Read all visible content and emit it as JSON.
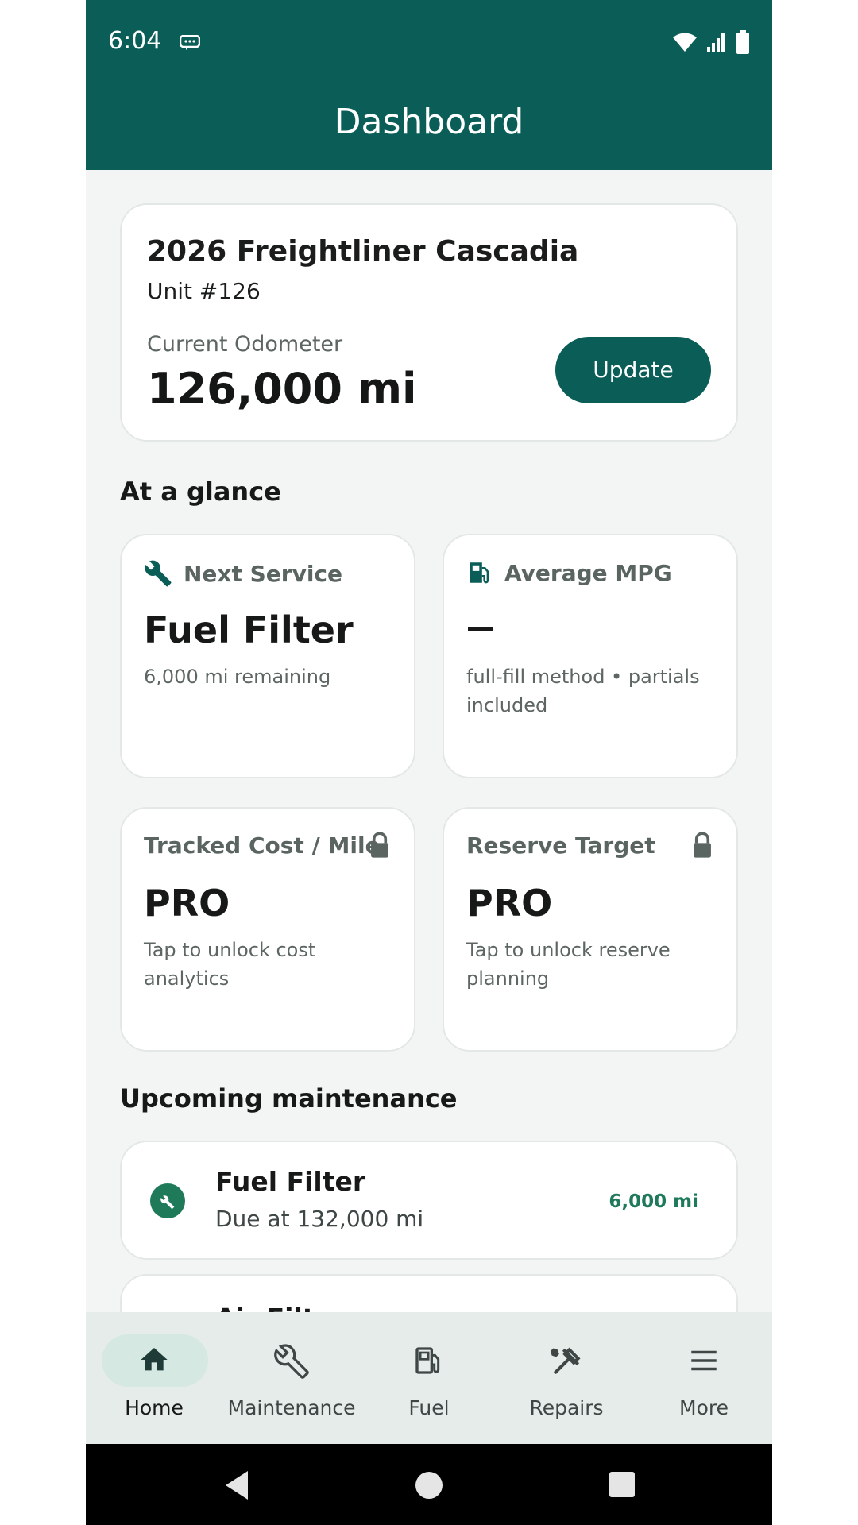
{
  "status_bar": {
    "time": "6:04"
  },
  "app_bar": {
    "title": "Dashboard"
  },
  "vehicle": {
    "name": "2026 Freightliner Cascadia",
    "unit": "Unit #126",
    "odometer_label": "Current Odometer",
    "odometer_value": "126,000 mi",
    "update_label": "Update"
  },
  "glance": {
    "title": "At a glance",
    "tiles": [
      {
        "label": "Next Service",
        "value": "Fuel Filter",
        "sub": "6,000 mi remaining",
        "icon": "wrench-icon"
      },
      {
        "label": "Average MPG",
        "value": "",
        "sub": "full-fill method • partials included",
        "icon": "fuel-pump-icon"
      },
      {
        "label": "Tracked Cost / Mile",
        "value": "PRO",
        "sub": "Tap to unlock cost analytics",
        "icon": "lock-icon"
      },
      {
        "label": "Reserve Target",
        "value": "PRO",
        "sub": "Tap to unlock reserve planning",
        "icon": "lock-icon"
      }
    ]
  },
  "upcoming": {
    "title": "Upcoming maintenance",
    "items": [
      {
        "title": "Fuel Filter",
        "sub": "Due at 132,000 mi",
        "badge": "6,000 mi"
      },
      {
        "title": "Air Filter"
      }
    ]
  },
  "bottom_nav": {
    "items": [
      {
        "label": "Home",
        "icon": "home-icon",
        "active": true
      },
      {
        "label": "Maintenance",
        "icon": "wrench-icon"
      },
      {
        "label": "Fuel",
        "icon": "fuel-pump-icon"
      },
      {
        "label": "Repairs",
        "icon": "tools-icon"
      },
      {
        "label": "More",
        "icon": "menu-icon"
      }
    ]
  },
  "colors": {
    "primary": "#0b5e58",
    "accent": "#1f7a5a",
    "background": "#f3f5f4"
  }
}
